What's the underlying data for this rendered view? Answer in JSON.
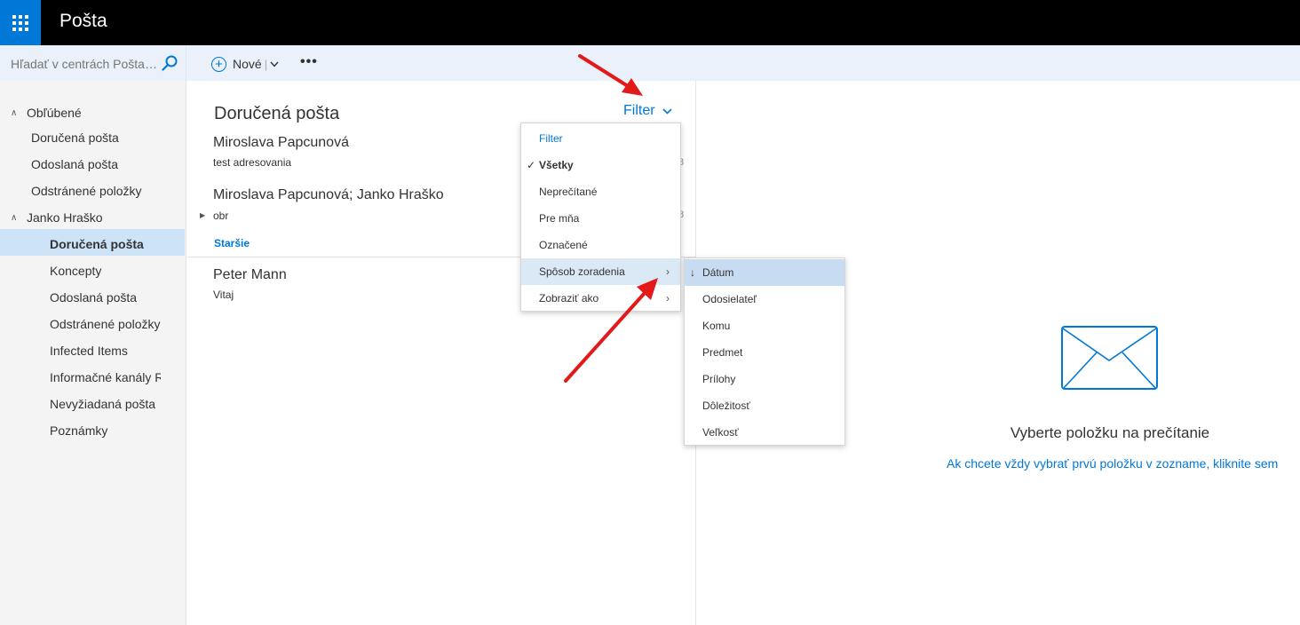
{
  "app": {
    "title": "Pošta"
  },
  "search": {
    "placeholder": "Hľadať v centrách Pošta a..."
  },
  "toolbar": {
    "new_label": "Nové",
    "more_label": "•••"
  },
  "nav": {
    "favorites_label": "Obľúbené",
    "favorites": [
      "Doručená pošta",
      "Odoslaná pošta",
      "Odstránené položky"
    ],
    "account_label": "Janko Hraško",
    "account_items": [
      "Doručená pošta",
      "Koncepty",
      "Odoslaná pošta",
      "Odstránené položky",
      "Infected Items",
      "Informačné kanály RSS",
      "Nevyžiadaná pošta",
      "Poznámky"
    ],
    "selected": "Doručená pošta"
  },
  "list": {
    "folder_title": "Doručená pošta",
    "filter_label": "Filter",
    "older_group": "Staršie",
    "messages": [
      {
        "sender": "Miroslava Papcunová",
        "subject": "test adresovania",
        "time": "8"
      },
      {
        "sender": "Miroslava Papcunová; Janko Hraško",
        "subject": "obr",
        "time": "8"
      },
      {
        "sender": "Peter Mann",
        "subject": "Vitaj",
        "time": ""
      }
    ]
  },
  "filter_menu": {
    "header": "Filter",
    "items": [
      "Všetky",
      "Neprečítané",
      "Pre mňa",
      "Označené",
      "Spôsob zoradenia",
      "Zobraziť ako"
    ],
    "checked": "Všetky"
  },
  "sort_menu": {
    "items": [
      "Dátum",
      "Odosielateľ",
      "Komu",
      "Predmet",
      "Prílohy",
      "Dôležitosť",
      "Veľkosť"
    ],
    "selected": "Dátum"
  },
  "reading": {
    "message": "Vyberte položku na prečítanie",
    "link": "Ak chcete vždy vybrať prvú položku v zozname, kliknite sem"
  },
  "colors": {
    "accent": "#0078d7",
    "topbar": "#000000",
    "selection": "#cde3f7",
    "arrow": "#e21a1a"
  }
}
